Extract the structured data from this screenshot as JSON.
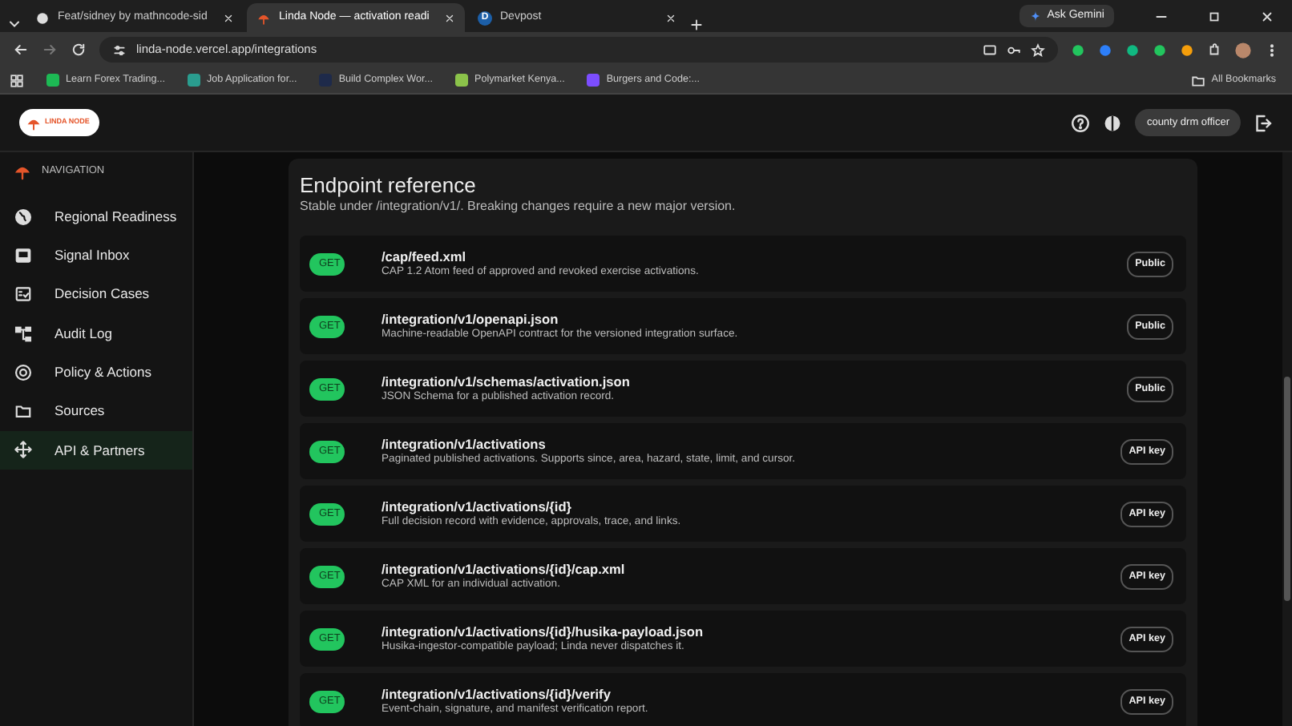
{
  "browser": {
    "tabs": [
      {
        "label": "Feat/sidney by mathncode-sid",
        "selected": false
      },
      {
        "label": "Linda Node — activation readi",
        "selected": true
      },
      {
        "label": "Devpost",
        "selected": false,
        "letter": "D"
      }
    ],
    "ask_button": "Ask Gemini",
    "address": "linda-node.vercel.app/integrations",
    "bookmarks": [
      {
        "label": "Learn Forex Trading...",
        "color": "#1db954"
      },
      {
        "label": "Job Application for...",
        "color": "#2a9d8f"
      },
      {
        "label": "Build Complex Wor...",
        "color": "#1e2a4a"
      },
      {
        "label": "Polymarket Kenya...",
        "color": "#8bc34a"
      },
      {
        "label": "Burgers and Code:...",
        "color": "#7c4dff"
      }
    ],
    "all_bookmarks": "All Bookmarks"
  },
  "header": {
    "logo_text": "LINDA NODE",
    "user": "county drm officer"
  },
  "sidebar": {
    "title": "NAVIGATION",
    "items": [
      {
        "label": "Regional Readiness",
        "selected": false
      },
      {
        "label": "Signal Inbox",
        "selected": false
      },
      {
        "label": "Decision Cases",
        "selected": false
      },
      {
        "label": "Audit Log",
        "selected": false
      },
      {
        "label": "Policy & Actions",
        "selected": false
      },
      {
        "label": "Sources",
        "selected": false
      },
      {
        "label": "API & Partners",
        "selected": true
      }
    ]
  },
  "panel": {
    "title": "Endpoint reference",
    "subtitle": "Stable under /integration/v1/. Breaking changes require a new major version.",
    "endpoints": [
      {
        "method": "GET",
        "path": "/cap/feed.xml",
        "description": "CAP 1.2 Atom feed of approved and revoked exercise activations.",
        "access": "Public"
      },
      {
        "method": "GET",
        "path": "/integration/v1/openapi.json",
        "description": "Machine-readable OpenAPI contract for the versioned integration surface.",
        "access": "Public"
      },
      {
        "method": "GET",
        "path": "/integration/v1/schemas/activation.json",
        "description": "JSON Schema for a published activation record.",
        "access": "Public"
      },
      {
        "method": "GET",
        "path": "/integration/v1/activations",
        "description": "Paginated published activations. Supports since, area, hazard, state, limit, and cursor.",
        "access": "API key"
      },
      {
        "method": "GET",
        "path": "/integration/v1/activations/{id}",
        "description": "Full decision record with evidence, approvals, trace, and links.",
        "access": "API key"
      },
      {
        "method": "GET",
        "path": "/integration/v1/activations/{id}/cap.xml",
        "description": "CAP XML for an individual activation.",
        "access": "API key"
      },
      {
        "method": "GET",
        "path": "/integration/v1/activations/{id}/husika-payload.json",
        "description": "Husika-ingestor-compatible payload; Linda never dispatches it.",
        "access": "API key"
      },
      {
        "method": "GET",
        "path": "/integration/v1/activations/{id}/verify",
        "description": "Event-chain, signature, and manifest verification report.",
        "access": "API key"
      }
    ]
  }
}
